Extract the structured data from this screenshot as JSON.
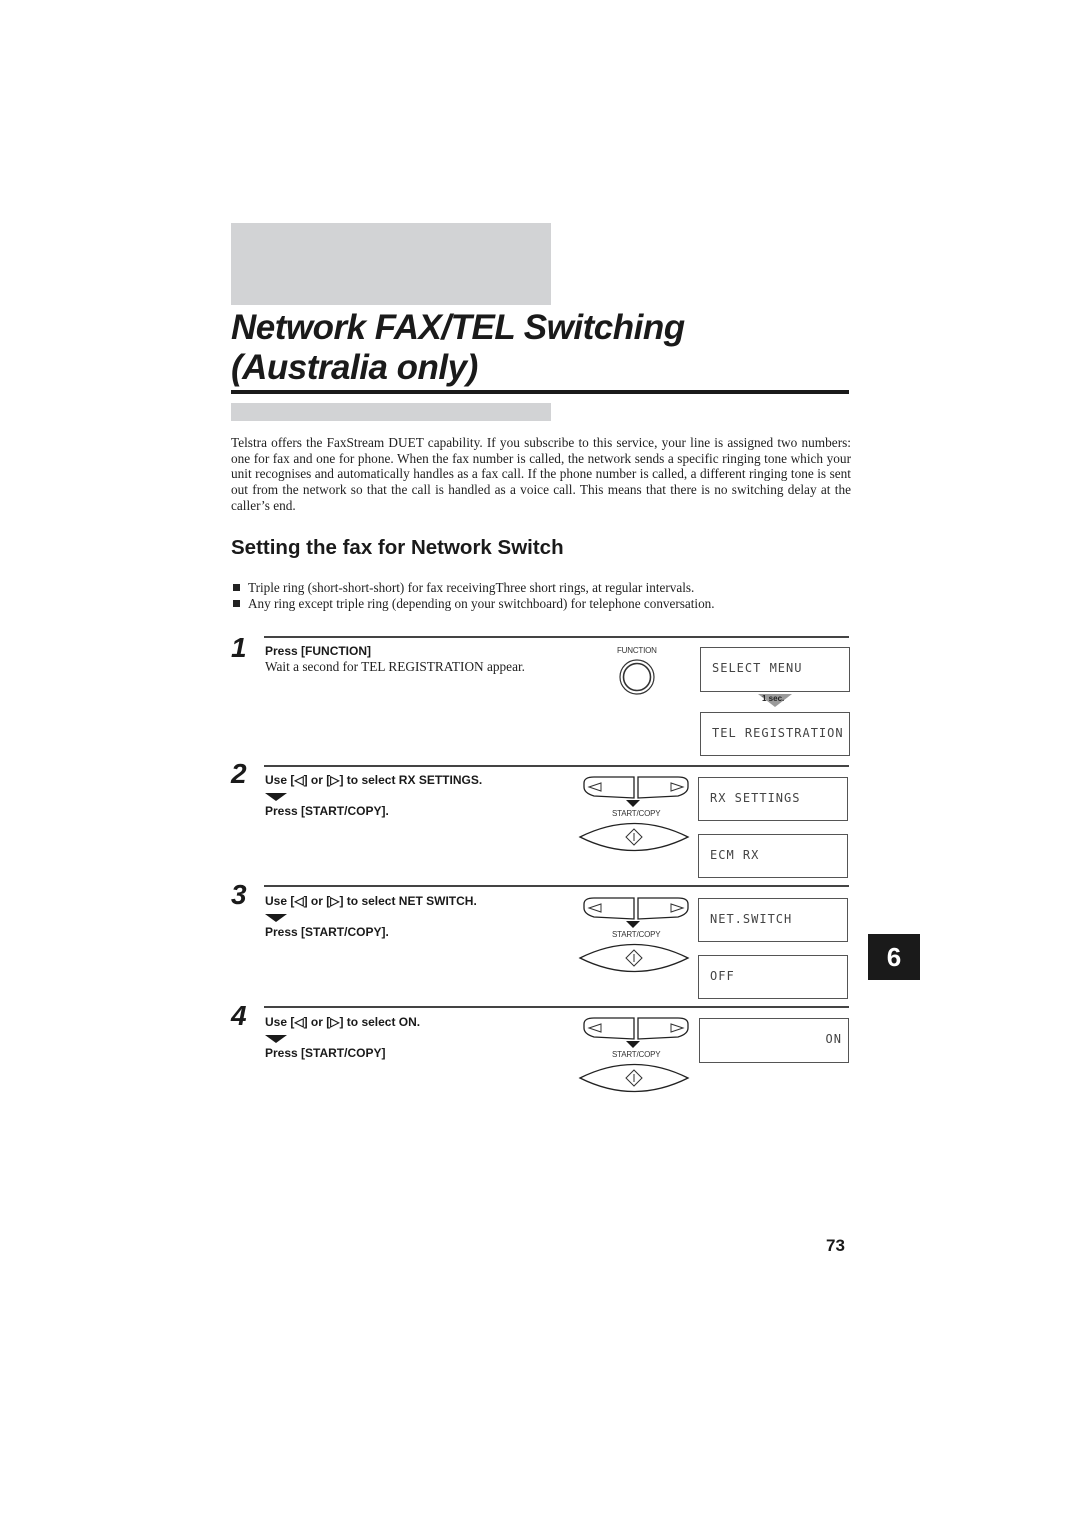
{
  "page": {
    "title_line1": "Network FAX/TEL Switching",
    "title_line2": "(Australia only)",
    "intro": "Telstra offers the FaxStream DUET capability. If you subscribe to this service, your line is assigned two numbers: one for fax and one for phone. When the fax number is called, the network sends a specific ringing tone which your unit recognises and automatically handles as a fax call. If the phone number is called, a different ringing tone is sent out from the network so that the call is handled as a voice call. This means that there is no switching delay at the caller’s end.",
    "subheading": "Setting the fax for Network Switch",
    "bullets": [
      "Triple ring (short-short-short) for fax receivingThree short rings, at regular intervals.",
      "Any ring except triple ring (depending on your switchboard) for telephone conversation."
    ],
    "chapter_tab": "6",
    "page_number": "73"
  },
  "steps": [
    {
      "number": "1",
      "line1": "Press [FUNCTION]",
      "line2": "Wait a second for TEL REGISTRATION appear.",
      "button_label": "FUNCTION",
      "displays": [
        "SELECT MENU",
        "TEL REGISTRATION"
      ],
      "delay_label": "1 sec."
    },
    {
      "number": "2",
      "line1": "Use [◁] or [▷] to select RX SETTINGS.",
      "line2": "Press [START/COPY].",
      "button_label": "START/COPY",
      "displays": [
        "RX SETTINGS",
        "ECM RX"
      ]
    },
    {
      "number": "3",
      "line1": "Use [◁] or [▷] to select NET SWITCH.",
      "line2": "Press [START/COPY].",
      "button_label": "START/COPY",
      "displays": [
        "NET.SWITCH",
        "OFF"
      ]
    },
    {
      "number": "4",
      "line1": "Use [◁] or [▷] to select ON.",
      "line2": "Press [START/COPY]",
      "button_label": "START/COPY",
      "displays": [
        "ON"
      ]
    }
  ]
}
